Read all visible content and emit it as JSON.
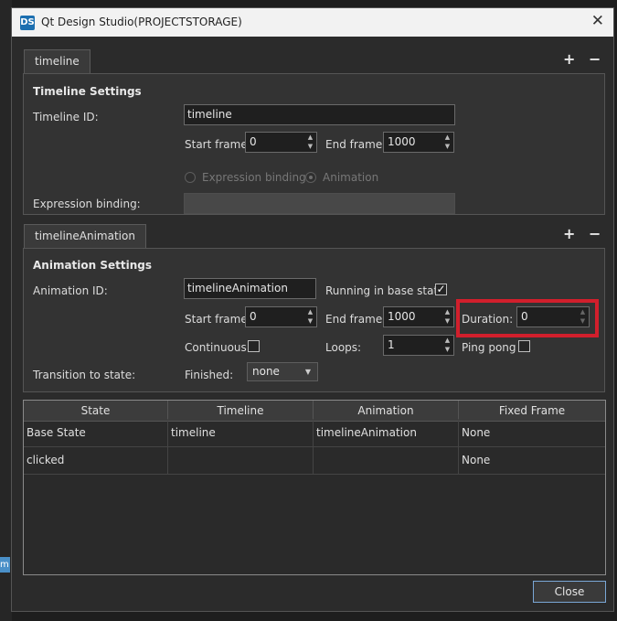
{
  "window": {
    "title": "Qt Design Studio(PROJECTSTORAGE)",
    "icon": "DS",
    "close_glyph": "✕"
  },
  "background": {
    "chip_text": "m"
  },
  "timeline": {
    "tab_label": "timeline",
    "add_glyph": "+",
    "remove_glyph": "−",
    "section_title": "Timeline Settings",
    "id_label": "Timeline ID:",
    "id_value": "timeline",
    "start_label": "Start frame:",
    "start_value": "0",
    "end_label": "End frame:",
    "end_value": "1000",
    "radio_expression": "Expression binding",
    "radio_animation": "Animation",
    "radio_selected": "Animation",
    "expr_label": "Expression binding:",
    "expr_value": ""
  },
  "animation": {
    "tab_label": "timelineAnimation",
    "add_glyph": "+",
    "remove_glyph": "−",
    "section_title": "Animation Settings",
    "id_label": "Animation ID:",
    "id_value": "timelineAnimation",
    "running_label": "Running in base state",
    "running_checked": true,
    "check_glyph": "✓",
    "start_label": "Start frame:",
    "start_value": "0",
    "end_label": "End frame:",
    "end_value": "1000",
    "duration_label": "Duration:",
    "duration_value": "0",
    "continuous_label": "Continuous",
    "continuous_checked": false,
    "loops_label": "Loops:",
    "loops_value": "1",
    "pingpong_label": "Ping pong",
    "pingpong_checked": false,
    "transition_label": "Transition to state:",
    "finished_label": "Finished:",
    "finished_value": "none"
  },
  "table": {
    "columns": [
      "State",
      "Timeline",
      "Animation",
      "Fixed Frame"
    ],
    "rows": [
      [
        "Base State",
        "timeline",
        "timelineAnimation",
        "None"
      ],
      [
        "clicked",
        "",
        "",
        "None"
      ]
    ]
  },
  "footer": {
    "close_label": "Close"
  },
  "colors": {
    "highlight": "#d11f2c",
    "accent": "#1c6fb0"
  }
}
